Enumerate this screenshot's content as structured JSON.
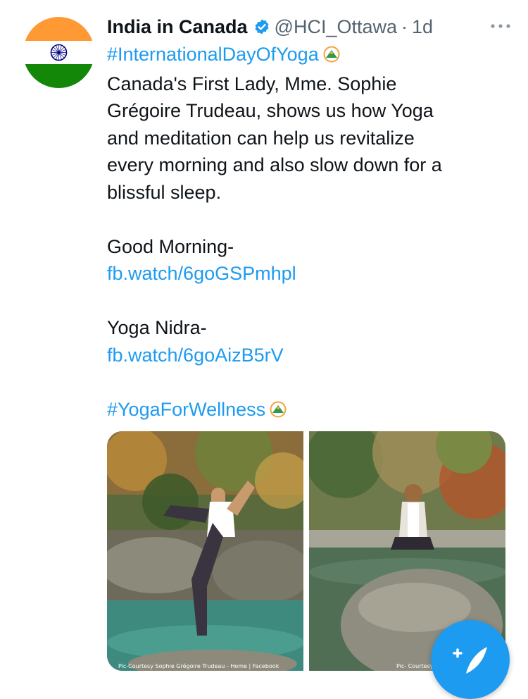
{
  "author": {
    "name": "India in Canada",
    "handle": "@HCI_Ottawa",
    "separator": "·",
    "time": "1d",
    "verified": true
  },
  "tweet": {
    "hashtag_1": "#InternationalDayOfYoga",
    "body_lines": [
      "Canada's First Lady,  Mme. Sophie",
      "Grégoire Trudeau, shows us how Yoga",
      "and meditation can help us revitalize",
      "every morning and also slow down for a",
      "blissful sleep."
    ],
    "good_morning_label": "Good Morning-",
    "good_morning_link": "fb.watch/6goGSPmhpl",
    "yoga_nidra_label": "Yoga Nidra-",
    "yoga_nidra_link": "fb.watch/6goAizB5rV",
    "hashtag_2": "#YogaForWellness"
  },
  "media": {
    "photo_1_caption": "Pic-Courtesy Sophie Grégoire Trudeau - Home | Facebook",
    "photo_2_caption": "Pic- Courtesy"
  },
  "icons": {
    "verified": "verified-badge-icon",
    "more": "more-options-icon",
    "hashtag_emoji": "yoga-hashflag-icon",
    "compose": "compose-tweet-icon"
  },
  "colors": {
    "link": "#1d9bf0",
    "secondary_text": "#536471",
    "saffron": "#FF9933",
    "green": "#138808",
    "chakra": "#000080"
  }
}
